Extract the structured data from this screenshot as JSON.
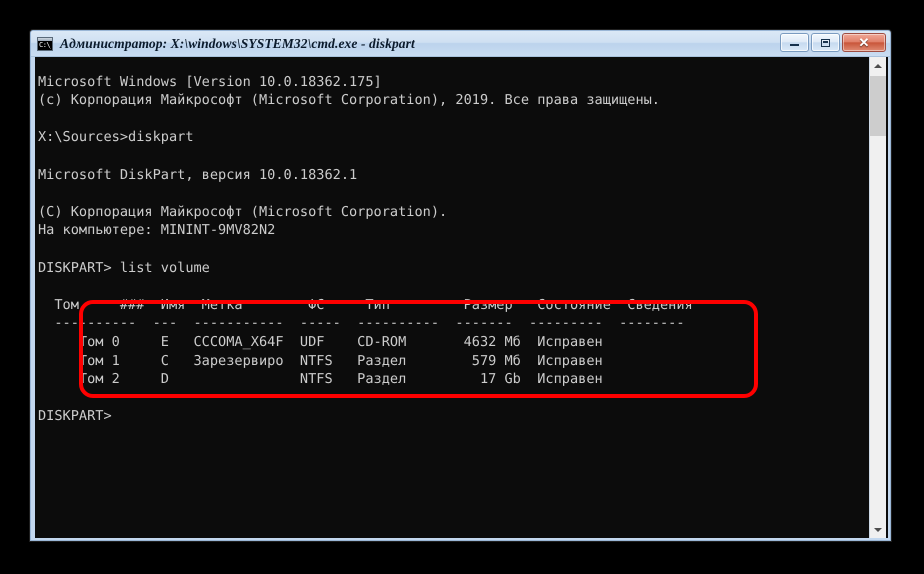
{
  "window": {
    "title": "Администратор: X:\\windows\\SYSTEM32\\cmd.exe - diskpart",
    "icon_glyph": "C:\\_",
    "buttons": {
      "minimize_label": "",
      "maximize_label": "",
      "close_label": "✕"
    }
  },
  "scrollbar": {
    "up_label": "",
    "down_label": ""
  },
  "console": {
    "text": "Microsoft Windows [Version 10.0.18362.175]\n(c) Корпорация Майкрософт (Microsoft Corporation), 2019. Все права защищены.\n\nX:\\Sources>diskpart\n\nMicrosoft DiskPart, версия 10.0.18362.1\n\n(C) Корпорация Майкрософт (Microsoft Corporation).\nНа компьютере: MININT-9MV82N2\n\nDISKPART> list volume\n\n  Том     ###  Имя  Метка        ФС     Тип         Размер   Состояние  Сведения\n  ----------  ---  -----------  -----  ----------  -------  ---------  --------\n     Том 0     E   CCCOMA_X64F  UDF    CD-ROM       4632 Мб  Исправен\n     Том 1     C   Зарезервиро  NTFS   Раздел        579 Мб  Исправен\n     Том 2     D                NTFS   Раздел         17 Gb  Исправен\n\nDISKPART>",
    "lines": [
      "Microsoft Windows [Version 10.0.18362.175]",
      "(c) Корпорация Майкрософт (Microsoft Corporation), 2019. Все права защищены.",
      "",
      "X:\\Sources>diskpart",
      "",
      "Microsoft DiskPart, версия 10.0.18362.1",
      "",
      "(C) Корпорация Майкрософт (Microsoft Corporation).",
      "На компьютере: MININT-9MV82N2",
      "",
      "DISKPART> list volume",
      "",
      "  Том     ###  Имя  Метка        ФС     Тип         Размер   Состояние  Сведения",
      "  ----------  ---  -----------  -----  ----------  -------  ---------  --------",
      "     Том 0     E   CCCOMA_X64F  UDF    CD-ROM       4632 Мб  Исправен",
      "     Том 1     C   Зарезервиро  NTFS   Раздел        579 Мб  Исправен",
      "     Том 2     D                NTFS   Раздел         17 Gb  Исправен",
      "",
      "DISKPART>"
    ],
    "commands": [
      "diskpart",
      "list volume"
    ],
    "prompt": "DISKPART>",
    "machine_name": "MININT-9MV82N2",
    "diskpart_version": "10.0.18362.1",
    "windows_version": "10.0.18362.175"
  },
  "volume_table": {
    "headers": [
      "Том",
      "###",
      "Имя",
      "Метка",
      "ФС",
      "Тип",
      "Размер",
      "Состояние",
      "Сведения"
    ],
    "rows": [
      [
        "Том 0",
        "",
        "E",
        "CCCOMA_X64F",
        "UDF",
        "CD-ROM",
        "4632 Мб",
        "Исправен",
        ""
      ],
      [
        "Том 1",
        "",
        "C",
        "Зарезервиро",
        "NTFS",
        "Раздел",
        "579 Мб",
        "Исправен",
        ""
      ],
      [
        "Том 2",
        "",
        "D",
        "",
        "NTFS",
        "Раздел",
        "17 Gb",
        "Исправен",
        ""
      ]
    ]
  },
  "annotation": {
    "highlight_color": "#fe0000",
    "shape": "rounded-rectangle"
  },
  "colors": {
    "console_background": "#0c0c0c",
    "console_text": "#cccccc",
    "window_frame": "#c3d8ef",
    "titlebar_text": "#0b1a2b"
  }
}
